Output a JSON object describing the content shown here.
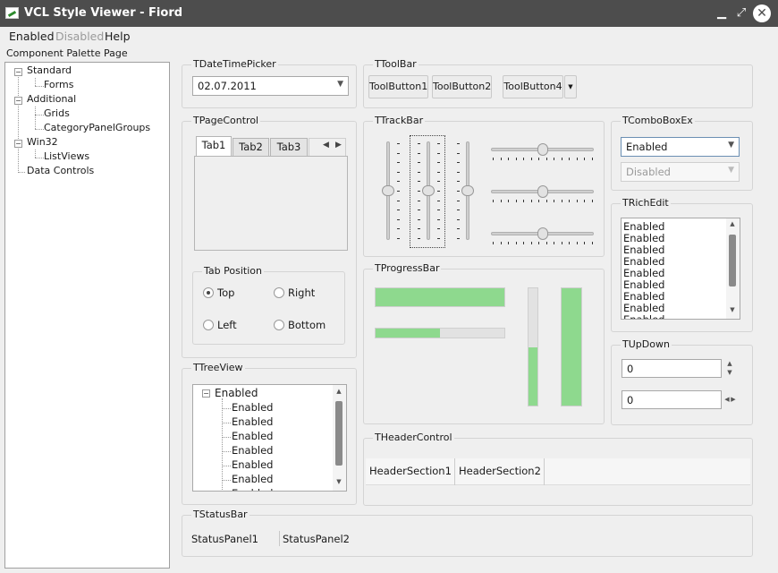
{
  "window": {
    "title": "VCL Style Viewer - Fiord",
    "minimize": "▁",
    "maximize": "⤢",
    "close": "✕"
  },
  "menu": [
    "Enabled",
    "Disabled",
    "Help"
  ],
  "palette_label": "Component Palette Page",
  "palette_tree": [
    {
      "label": "Standard",
      "level": 0,
      "expand": "−"
    },
    {
      "label": "Forms",
      "level": 1
    },
    {
      "label": "Additional",
      "level": 0,
      "expand": "−"
    },
    {
      "label": "Grids",
      "level": 1
    },
    {
      "label": "CategoryPanelGroups",
      "level": 1
    },
    {
      "label": "Win32",
      "level": 0,
      "expand": "−"
    },
    {
      "label": "ListViews",
      "level": 1
    },
    {
      "label": "Data Controls",
      "level": 0
    }
  ],
  "groups": {
    "datetimepicker": "TDateTimePicker",
    "toolbar": "TToolBar",
    "pagecontrol": "TPageControl",
    "trackbar": "TTrackBar",
    "comboboxex": "TComboBoxEx",
    "tabposition": "Tab Position",
    "richedit": "TRichEdit",
    "progressbar": "TProgressBar",
    "updown": "TUpDown",
    "treeview": "TTreeView",
    "headercontrol": "THeaderControl",
    "statusbar": "TStatusBar"
  },
  "datetimepicker": {
    "value": "02.07.2011"
  },
  "toolbar": {
    "buttons": [
      "ToolButton1",
      "ToolButton2",
      "ToolButton4"
    ]
  },
  "pagecontrol": {
    "tabs": [
      "Tab1",
      "Tab2",
      "Tab3"
    ],
    "active": 0
  },
  "tab_position": {
    "options": [
      "Top",
      "Right",
      "Left",
      "Bottom"
    ],
    "selected": "Top"
  },
  "trackbar": {
    "vertical_levels": [
      0.5,
      0.5,
      0.5
    ],
    "horizontal_levels": [
      0.5,
      0.5,
      0.5
    ]
  },
  "comboboxex": {
    "enabled_value": "Enabled",
    "disabled_value": "Disabled"
  },
  "richedit": {
    "lines": [
      "Enabled",
      "Enabled",
      "Enabled",
      "Enabled",
      "Enabled",
      "Enabled",
      "Enabled",
      "Enabled",
      "Enabled"
    ]
  },
  "progressbar": {
    "h1": 1.0,
    "h2": 0.5,
    "v1": 0.5,
    "v2": 1.0,
    "color": "#8ed98e"
  },
  "updown": {
    "value1": "0",
    "value2": "0"
  },
  "treeview": {
    "root": "Enabled",
    "children": [
      "Enabled",
      "Enabled",
      "Enabled",
      "Enabled",
      "Enabled",
      "Enabled",
      "Enabled"
    ]
  },
  "header": {
    "sections": [
      "HeaderSection1",
      "HeaderSection2"
    ]
  },
  "statusbar": {
    "panels": [
      "StatusPanel1",
      "StatusPanel2"
    ]
  }
}
